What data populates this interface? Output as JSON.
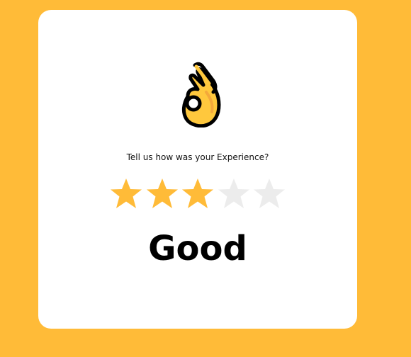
{
  "prompt": "Tell us how was your Experience?",
  "rating": {
    "value": 3,
    "max": 5,
    "label": "Good"
  },
  "emoji_icon": "ok-hand-icon",
  "colors": {
    "background": "#FFBB38",
    "card": "#FFFFFF",
    "star_filled": "#FFBB38",
    "star_empty": "#ECECEC",
    "text": "#000000"
  }
}
